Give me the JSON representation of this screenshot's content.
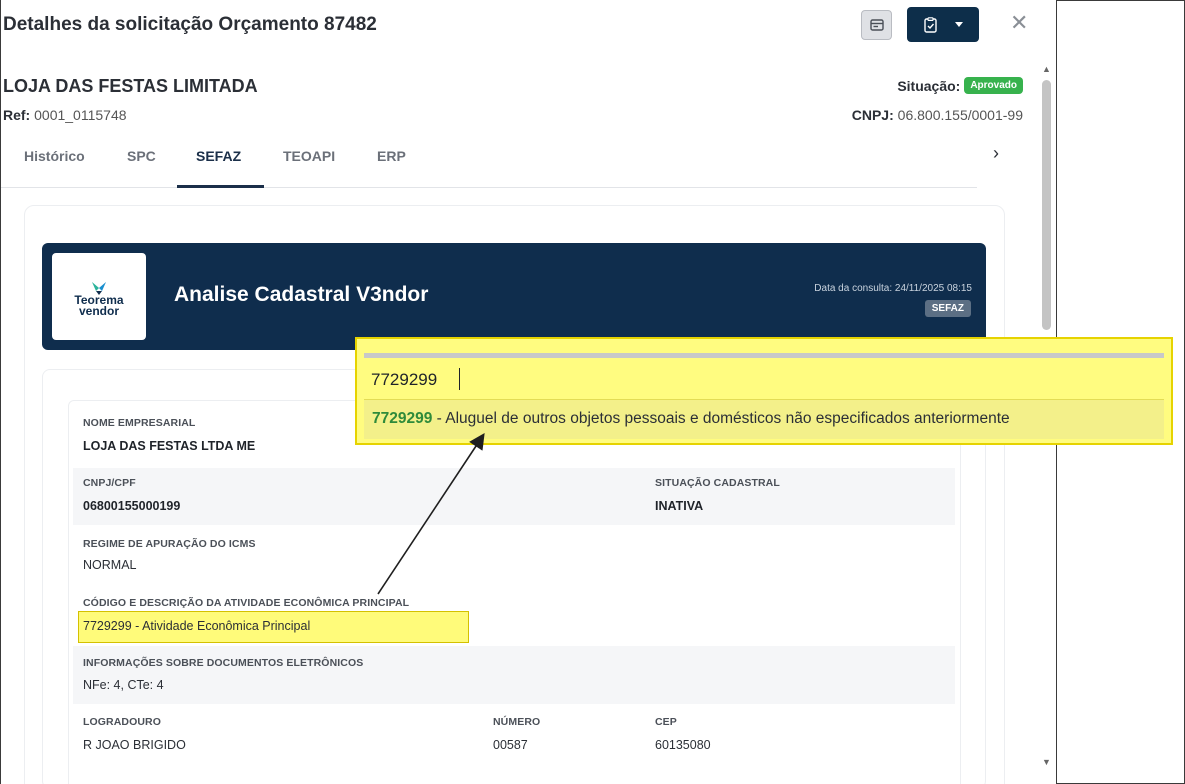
{
  "modal": {
    "title": "Detalhes da solicitação Orçamento 87482",
    "close_icon": "close-icon"
  },
  "header": {
    "company": "LOJA DAS FESTAS LIMITADA",
    "ref_label": "Ref:",
    "ref_value": "0001_0115748",
    "status_label": "Situação:",
    "status_badge": "Aprovado",
    "cnpj_label": "CNPJ:",
    "cnpj_value": "06.800.155/0001-99"
  },
  "tabs": [
    {
      "label": "Histórico"
    },
    {
      "label": "SPC"
    },
    {
      "label": "SEFAZ"
    },
    {
      "label": "TEOAPI"
    },
    {
      "label": "ERP"
    }
  ],
  "banner": {
    "logo_top": "Teorema",
    "logo_bottom": "vendor",
    "title": "Analise Cadastral V3ndor",
    "consult_date": "Data da consulta: 24/11/2025 08:15",
    "source_tag": "SEFAZ"
  },
  "fields": {
    "nome_label": "NOME EMPRESARIAL",
    "nome_value": "LOJA DAS FESTAS LTDA ME",
    "cnpj_label": "CNPJ/CPF",
    "cnpj_value": "06800155000199",
    "situacao_label": "SITUAÇÃO CADASTRAL",
    "situacao_value": "INATIVA",
    "regime_label": "REGIME DE APURAÇÃO DO ICMS",
    "regime_value": "NORMAL",
    "atividade_label": "CÓDIGO E DESCRIÇÃO DA ATIVIDADE ECONÔMICA PRINCIPAL",
    "atividade_value": "7729299 - Atividade Econômica Principal",
    "docs_label": "INFORMAÇÕES SOBRE DOCUMENTOS ELETRÔNICOS",
    "docs_value": "NFe: 4, CTe: 4",
    "logradouro_label": "LOGRADOURO",
    "logradouro_value": "R JOAO BRIGIDO",
    "numero_label": "NÚMERO",
    "numero_value": "00587",
    "cep_label": "CEP",
    "cep_value": "60135080"
  },
  "popup": {
    "search_value": "7729299",
    "result_code": "7729299",
    "result_text": " - Aluguel de outros objetos pessoais e domésticos não especificados anteriormente"
  },
  "colors": {
    "navy": "#0f2d4d",
    "approved": "#37b24d",
    "highlight": "#fffc80",
    "result_code": "#2e8a3a"
  }
}
